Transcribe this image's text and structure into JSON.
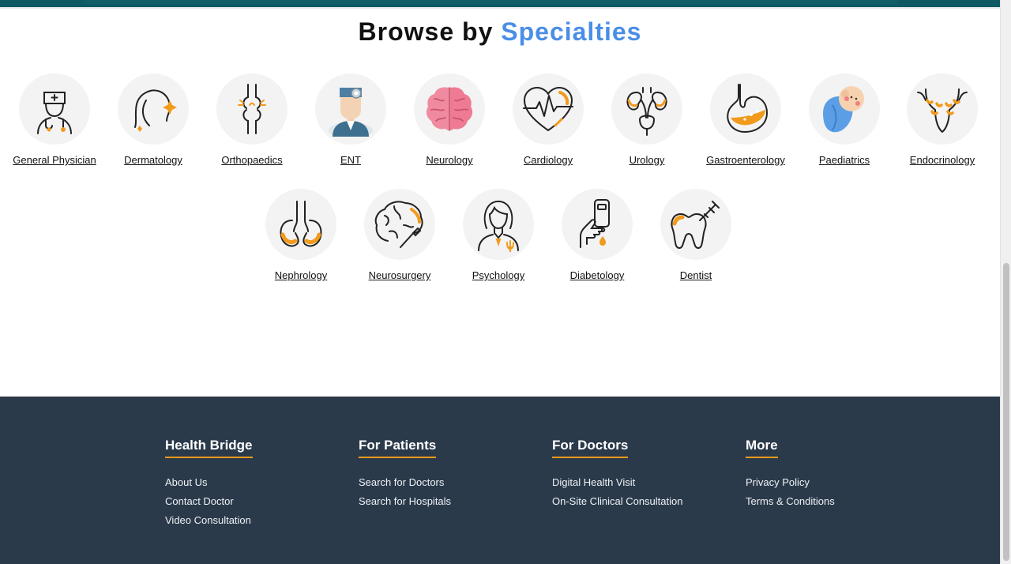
{
  "colors": {
    "accent_blue": "#4a8ee6",
    "accent_orange": "#f29a1c",
    "footer_bg": "#2b3a4a",
    "top_bar": "#0f5a62"
  },
  "heading": {
    "prefix": "Browse by",
    "accent": "Specialties"
  },
  "specialties": [
    {
      "label": "General Physician",
      "icon": "doctor-icon"
    },
    {
      "label": "Dermatology",
      "icon": "skin-face-icon"
    },
    {
      "label": "Orthopaedics",
      "icon": "bone-joint-icon"
    },
    {
      "label": "ENT",
      "icon": "ent-doctor-icon"
    },
    {
      "label": "Neurology",
      "icon": "brain-icon"
    },
    {
      "label": "Cardiology",
      "icon": "heartbeat-icon"
    },
    {
      "label": "Urology",
      "icon": "kidney-bladder-icon"
    },
    {
      "label": "Gastroenterology",
      "icon": "stomach-icon"
    },
    {
      "label": "Paediatrics",
      "icon": "baby-icon"
    },
    {
      "label": "Endocrinology",
      "icon": "thyroid-icon"
    },
    {
      "label": "Nephrology",
      "icon": "kidneys-icon"
    },
    {
      "label": "Neurosurgery",
      "icon": "brain-scalpel-icon"
    },
    {
      "label": "Psychology",
      "icon": "psychologist-icon"
    },
    {
      "label": "Diabetology",
      "icon": "glucometer-icon"
    },
    {
      "label": "Dentist",
      "icon": "tooth-icon"
    }
  ],
  "footer": {
    "col1": {
      "title": "Health Bridge",
      "links": [
        "About Us",
        "Contact Doctor",
        "Video Consultation"
      ]
    },
    "col2": {
      "title": "For Patients",
      "links": [
        "Search for Doctors",
        "Search for Hospitals"
      ]
    },
    "col3": {
      "title": "For Doctors",
      "links": [
        "Digital Health Visit",
        "On-Site Clinical Consultation"
      ]
    },
    "col4": {
      "title": "More",
      "links": [
        "Privacy Policy",
        "Terms & Conditions"
      ]
    }
  }
}
